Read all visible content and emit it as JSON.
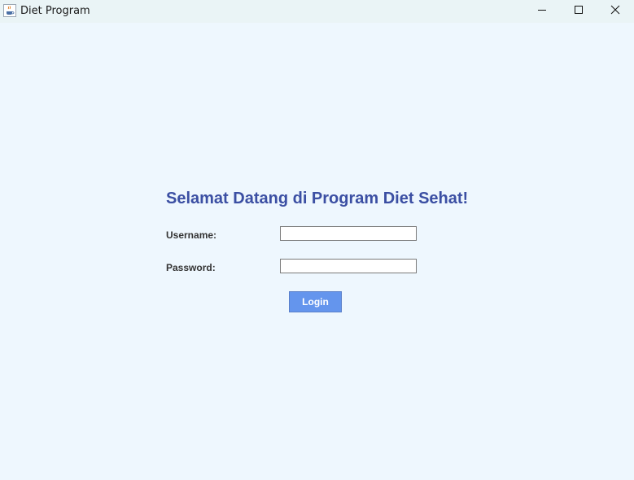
{
  "window": {
    "title": "Diet Program",
    "icons": {
      "app": "java-coffee-cup-icon",
      "minimize": "minimize-icon",
      "maximize": "maximize-icon",
      "close": "close-icon"
    }
  },
  "login": {
    "heading": "Selamat Datang di Program Diet Sehat!",
    "username_label": "Username:",
    "username_value": "",
    "password_label": "Password:",
    "password_value": "",
    "login_button": "Login"
  },
  "colors": {
    "background": "#eef7fe",
    "heading": "#3b4fa3",
    "button": "#6495ed",
    "button_text": "#ffffff"
  }
}
